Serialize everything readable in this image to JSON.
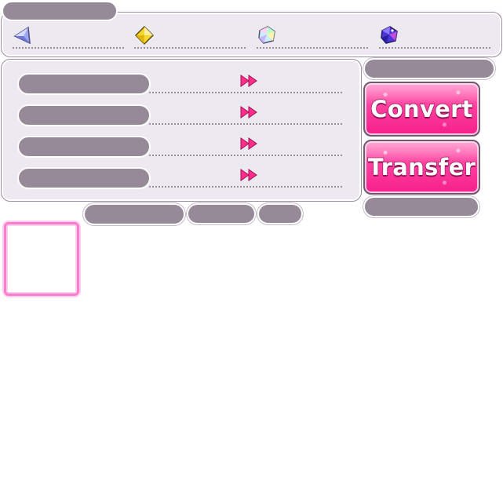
{
  "currencies": [
    {
      "name": "blue-crystal",
      "icon": "triangle-crystal-icon",
      "color": "#7d86e6"
    },
    {
      "name": "gold-crystal",
      "icon": "diamond-crystal-icon",
      "color": "#f4d51d"
    },
    {
      "name": "rainbow-crystal",
      "icon": "prism-crystal-icon",
      "color": "#9ee3f5"
    },
    {
      "name": "purple-crystal",
      "icon": "gem-crystal-icon",
      "color": "#4a2fd6"
    }
  ],
  "conversion_rows": [
    {
      "arrow_icon": "double-arrow-right-icon"
    },
    {
      "arrow_icon": "double-arrow-right-icon"
    },
    {
      "arrow_icon": "double-arrow-right-icon"
    },
    {
      "arrow_icon": "double-arrow-right-icon"
    }
  ],
  "actions": {
    "convert_label": "Convert",
    "transfer_label": "Transfer"
  },
  "colors": {
    "accent_pink": "#ff3f9e",
    "pill_gray": "#968a98",
    "panel_bg": "#ede9f0",
    "frame_pink": "#ff7ccc"
  }
}
